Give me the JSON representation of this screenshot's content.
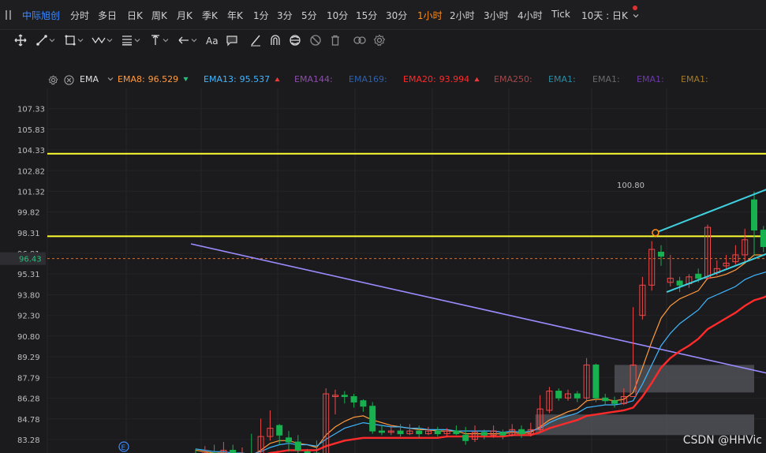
{
  "topbar": {
    "stock_name": "中际旭创",
    "periods": [
      "分时",
      "多日",
      "日K",
      "周K",
      "月K",
      "季K",
      "年K",
      "1分",
      "3分",
      "5分",
      "10分",
      "15分",
      "30分",
      "1小时",
      "2小时",
      "3小时",
      "4小时",
      "Tick"
    ],
    "active_period": "1小时",
    "multi_view": "10天 : 日K",
    "notification_color": "#e03030"
  },
  "toolbar": {
    "icons": [
      "move-cross-icon",
      "line-segment-icon",
      "rectangle-icon",
      "wave-pattern-icon",
      "fibonacci-icon",
      "measure-icon",
      "arrow-icon",
      "text-aa-icon",
      "comment-icon",
      "pen-icon",
      "magnet-icon",
      "hide-drawings-icon",
      "eye-off-icon",
      "trash-icon",
      "link-icon",
      "settings-icon"
    ]
  },
  "legend": {
    "indicator": "EMA",
    "items": [
      {
        "label": "EMA8:",
        "value": "96.529",
        "color": "#ff9b3d",
        "arrow": "down",
        "arrow_color": "#27c07d"
      },
      {
        "label": "EMA13:",
        "value": "95.537",
        "color": "#3fb6ff",
        "arrow": "up",
        "arrow_color": "#f03a3a"
      },
      {
        "label": "EMA144:",
        "value": "",
        "color": "#8b4fa8",
        "arrow": ""
      },
      {
        "label": "EMA169:",
        "value": "",
        "color": "#2f5fa8",
        "arrow": ""
      },
      {
        "label": "EMA20:",
        "value": "93.994",
        "color": "#ff2a2a",
        "arrow": "up",
        "arrow_color": "#f03a3a"
      },
      {
        "label": "EMA250:",
        "value": "",
        "color": "#a0484a",
        "arrow": ""
      },
      {
        "label": "EMA1:",
        "value": "",
        "color": "#2a8ba0",
        "arrow": ""
      },
      {
        "label": "EMA1:",
        "value": "",
        "color": "#6a6a6a",
        "arrow": ""
      },
      {
        "label": "EMA1:",
        "value": "",
        "color": "#6a3aa8",
        "arrow": ""
      },
      {
        "label": "EMA1:",
        "value": "",
        "color": "#a07a2a",
        "arrow": ""
      }
    ]
  },
  "chart_data": {
    "type": "candlestick",
    "y_ticks": [
      "107.33",
      "105.83",
      "104.33",
      "102.82",
      "101.32",
      "99.82",
      "98.31",
      "96.81",
      "95.31",
      "93.80",
      "92.30",
      "90.80",
      "89.29",
      "87.79",
      "86.28",
      "84.78",
      "83.28"
    ],
    "ylim": [
      82.3,
      108.8
    ],
    "current_price": "96.43",
    "current_price_color": "#27c07d",
    "horizontal_lines": [
      {
        "price": 104.05,
        "color": "#ffff33"
      },
      {
        "price": 98.05,
        "color": "#ffff33"
      }
    ],
    "trend_line": {
      "color": "#9a8cff",
      "from": [
        -0.5,
        97.5
      ],
      "to": [
        80.5,
        85.2
      ]
    },
    "channel": {
      "color": "#3fd0e0",
      "upper": {
        "from": [
          49.4,
          98.31
        ],
        "to": [
          66.5,
          102.82
        ]
      },
      "lower": {
        "from": [
          50.6,
          94.0
        ],
        "to": [
          68.8,
          98.7
        ]
      },
      "label": "100.80"
    },
    "zones": [
      {
        "x0": 45.0,
        "x1": 60.0,
        "y0": 86.7,
        "y1": 88.7,
        "color": "#55585f"
      },
      {
        "x0": 36.5,
        "x1": 60.0,
        "y0": 83.6,
        "y1": 85.1,
        "color": "#55585f"
      }
    ],
    "marker": "E",
    "up_color": "#f04848",
    "down_color": "#17b14f",
    "candles": [
      {
        "o": 82.1,
        "c": 82.0,
        "h": 82.6,
        "l": 81.5
      },
      {
        "o": 82.0,
        "c": 82.3,
        "h": 82.8,
        "l": 81.8
      },
      {
        "o": 82.3,
        "c": 82.1,
        "h": 82.9,
        "l": 81.6
      },
      {
        "o": 82.1,
        "c": 82.5,
        "h": 83.1,
        "l": 81.9
      },
      {
        "o": 82.5,
        "c": 82.0,
        "h": 82.9,
        "l": 81.4
      },
      {
        "o": 82.0,
        "c": 82.2,
        "h": 82.7,
        "l": 81.5
      },
      {
        "o": 82.2,
        "c": 81.9,
        "h": 83.7,
        "l": 81.3
      },
      {
        "o": 81.9,
        "c": 83.5,
        "h": 84.8,
        "l": 81.7
      },
      {
        "o": 83.5,
        "c": 84.1,
        "h": 85.4,
        "l": 83.2
      },
      {
        "o": 84.3,
        "c": 83.6,
        "h": 84.4,
        "l": 82.9
      },
      {
        "o": 83.4,
        "c": 83.1,
        "h": 83.9,
        "l": 82.4
      },
      {
        "o": 83.1,
        "c": 82.5,
        "h": 83.6,
        "l": 82.2
      },
      {
        "o": 82.4,
        "c": 82.3,
        "h": 82.6,
        "l": 81.3
      },
      {
        "o": 82.3,
        "c": 82.1,
        "h": 83.2,
        "l": 81.2
      },
      {
        "o": 82.1,
        "c": 86.6,
        "h": 87.0,
        "l": 81.7
      },
      {
        "o": 86.4,
        "c": 86.5,
        "h": 86.9,
        "l": 85.1
      },
      {
        "o": 86.5,
        "c": 86.4,
        "h": 86.8,
        "l": 85.9
      },
      {
        "o": 86.4,
        "c": 86.0,
        "h": 86.6,
        "l": 85.6
      },
      {
        "o": 86.1,
        "c": 85.7,
        "h": 86.2,
        "l": 85.3
      },
      {
        "o": 85.7,
        "c": 83.9,
        "h": 86.0,
        "l": 83.7
      },
      {
        "o": 83.9,
        "c": 83.8,
        "h": 84.3,
        "l": 83.6
      },
      {
        "o": 83.8,
        "c": 83.9,
        "h": 84.3,
        "l": 83.6
      },
      {
        "o": 83.9,
        "c": 83.7,
        "h": 84.4,
        "l": 83.5
      },
      {
        "o": 83.7,
        "c": 83.9,
        "h": 84.4,
        "l": 83.6
      },
      {
        "o": 83.9,
        "c": 83.7,
        "h": 84.3,
        "l": 83.4
      },
      {
        "o": 83.7,
        "c": 83.9,
        "h": 84.2,
        "l": 83.6
      },
      {
        "o": 83.9,
        "c": 83.7,
        "h": 84.2,
        "l": 83.5
      },
      {
        "o": 83.7,
        "c": 83.9,
        "h": 84.1,
        "l": 83.5
      },
      {
        "o": 83.9,
        "c": 83.7,
        "h": 84.3,
        "l": 83.6
      },
      {
        "o": 83.6,
        "c": 83.2,
        "h": 84.2,
        "l": 82.9
      },
      {
        "o": 83.3,
        "c": 83.8,
        "h": 84.3,
        "l": 83.1
      },
      {
        "o": 83.8,
        "c": 83.6,
        "h": 84.0,
        "l": 83.3
      },
      {
        "o": 83.6,
        "c": 83.9,
        "h": 84.3,
        "l": 83.4
      },
      {
        "o": 83.8,
        "c": 83.6,
        "h": 84.0,
        "l": 83.3
      },
      {
        "o": 83.6,
        "c": 84.0,
        "h": 84.4,
        "l": 83.5
      },
      {
        "o": 84.0,
        "c": 83.7,
        "h": 84.3,
        "l": 83.4
      },
      {
        "o": 83.7,
        "c": 84.0,
        "h": 84.5,
        "l": 83.5
      },
      {
        "o": 84.0,
        "c": 85.5,
        "h": 86.5,
        "l": 83.8
      },
      {
        "o": 85.4,
        "c": 86.8,
        "h": 87.1,
        "l": 85.2
      },
      {
        "o": 86.8,
        "c": 86.3,
        "h": 87.0,
        "l": 86.1
      },
      {
        "o": 86.3,
        "c": 86.6,
        "h": 86.9,
        "l": 86.1
      },
      {
        "o": 86.6,
        "c": 86.3,
        "h": 86.8,
        "l": 86.0
      },
      {
        "o": 86.3,
        "c": 88.7,
        "h": 89.2,
        "l": 86.0
      },
      {
        "o": 88.7,
        "c": 86.3,
        "h": 88.8,
        "l": 86.0
      },
      {
        "o": 86.3,
        "c": 86.1,
        "h": 86.6,
        "l": 85.8
      },
      {
        "o": 86.1,
        "c": 85.9,
        "h": 86.4,
        "l": 85.6
      },
      {
        "o": 85.9,
        "c": 86.4,
        "h": 87.0,
        "l": 85.8
      },
      {
        "o": 86.4,
        "c": 88.7,
        "h": 92.9,
        "l": 88.6
      },
      {
        "o": 92.3,
        "c": 94.5,
        "h": 95.1,
        "l": 92.0
      },
      {
        "o": 94.5,
        "c": 97.1,
        "h": 97.7,
        "l": 94.1
      },
      {
        "o": 96.9,
        "c": 96.6,
        "h": 97.4,
        "l": 95.9
      },
      {
        "o": 94.7,
        "c": 95.0,
        "h": 96.7,
        "l": 94.4
      },
      {
        "o": 94.8,
        "c": 94.5,
        "h": 95.1,
        "l": 94.0
      },
      {
        "o": 94.6,
        "c": 95.1,
        "h": 95.3,
        "l": 94.3
      },
      {
        "o": 95.3,
        "c": 95.0,
        "h": 95.7,
        "l": 94.7
      },
      {
        "o": 95.0,
        "c": 98.7,
        "h": 98.9,
        "l": 94.9
      },
      {
        "o": 95.4,
        "c": 95.7,
        "h": 96.3,
        "l": 95.2
      },
      {
        "o": 95.9,
        "c": 96.1,
        "h": 96.7,
        "l": 95.7
      },
      {
        "o": 96.2,
        "c": 96.7,
        "h": 97.4,
        "l": 96.0
      },
      {
        "o": 96.7,
        "c": 97.8,
        "h": 98.6,
        "l": 96.2
      },
      {
        "o": 100.7,
        "c": 98.5,
        "h": 101.3,
        "l": 96.6
      },
      {
        "o": 98.5,
        "c": 97.3,
        "h": 98.8,
        "l": 96.9
      },
      {
        "o": 97.4,
        "c": 97.8,
        "h": 98.2,
        "l": 97.0
      },
      {
        "o": 97.7,
        "c": 96.4,
        "h": 97.9,
        "l": 96.2
      }
    ],
    "series": [
      {
        "name": "EMA8",
        "color": "#ff9b3d",
        "values": [
          82.5,
          82.4,
          82.3,
          82.3,
          82.2,
          82.2,
          82.1,
          82.5,
          83.0,
          83.2,
          83.2,
          83.0,
          82.9,
          82.7,
          83.6,
          84.2,
          84.6,
          84.9,
          85.0,
          84.7,
          84.5,
          84.3,
          84.2,
          84.1,
          84.0,
          84.0,
          83.9,
          83.9,
          83.9,
          83.7,
          83.7,
          83.7,
          83.7,
          83.7,
          83.8,
          83.7,
          83.8,
          84.2,
          84.7,
          85.0,
          85.3,
          85.5,
          86.1,
          86.2,
          86.2,
          86.1,
          86.2,
          86.7,
          88.5,
          90.4,
          92.1,
          93.0,
          93.5,
          93.8,
          94.1,
          95.0,
          95.1,
          95.3,
          95.6,
          96.1,
          96.7,
          96.7,
          96.9,
          96.5
        ]
      },
      {
        "name": "EMA13",
        "color": "#3fb6ff",
        "values": [
          82.6,
          82.5,
          82.4,
          82.4,
          82.3,
          82.3,
          82.2,
          82.4,
          82.7,
          82.9,
          83.0,
          82.9,
          82.9,
          82.8,
          83.3,
          83.7,
          84.1,
          84.3,
          84.5,
          84.4,
          84.3,
          84.2,
          84.2,
          84.1,
          84.1,
          84.0,
          84.0,
          84.0,
          83.9,
          83.9,
          83.9,
          83.9,
          83.9,
          83.8,
          83.9,
          83.8,
          83.9,
          84.1,
          84.5,
          84.8,
          85.0,
          85.2,
          85.6,
          85.7,
          85.8,
          85.8,
          85.9,
          86.1,
          87.3,
          88.7,
          90.1,
          91.0,
          91.7,
          92.2,
          92.7,
          93.5,
          93.8,
          94.1,
          94.4,
          94.9,
          95.2,
          95.4,
          95.6,
          95.5
        ]
      },
      {
        "name": "EMA20",
        "color": "#ff2a2a",
        "values": [
          82.2,
          82.1,
          82.1,
          82.1,
          82.0,
          82.0,
          82.0,
          82.1,
          82.3,
          82.4,
          82.5,
          82.5,
          82.5,
          82.5,
          82.8,
          83.0,
          83.2,
          83.3,
          83.4,
          83.4,
          83.4,
          83.4,
          83.4,
          83.4,
          83.4,
          83.4,
          83.4,
          83.5,
          83.5,
          83.5,
          83.5,
          83.5,
          83.5,
          83.5,
          83.6,
          83.6,
          83.6,
          83.8,
          84.1,
          84.3,
          84.5,
          84.7,
          85.0,
          85.1,
          85.2,
          85.3,
          85.4,
          85.6,
          86.4,
          87.4,
          88.5,
          89.2,
          89.7,
          90.1,
          90.6,
          91.3,
          91.7,
          92.1,
          92.5,
          93.0,
          93.4,
          93.6,
          93.9,
          94.0
        ]
      }
    ]
  },
  "watermark": "CSDN @HHVic"
}
